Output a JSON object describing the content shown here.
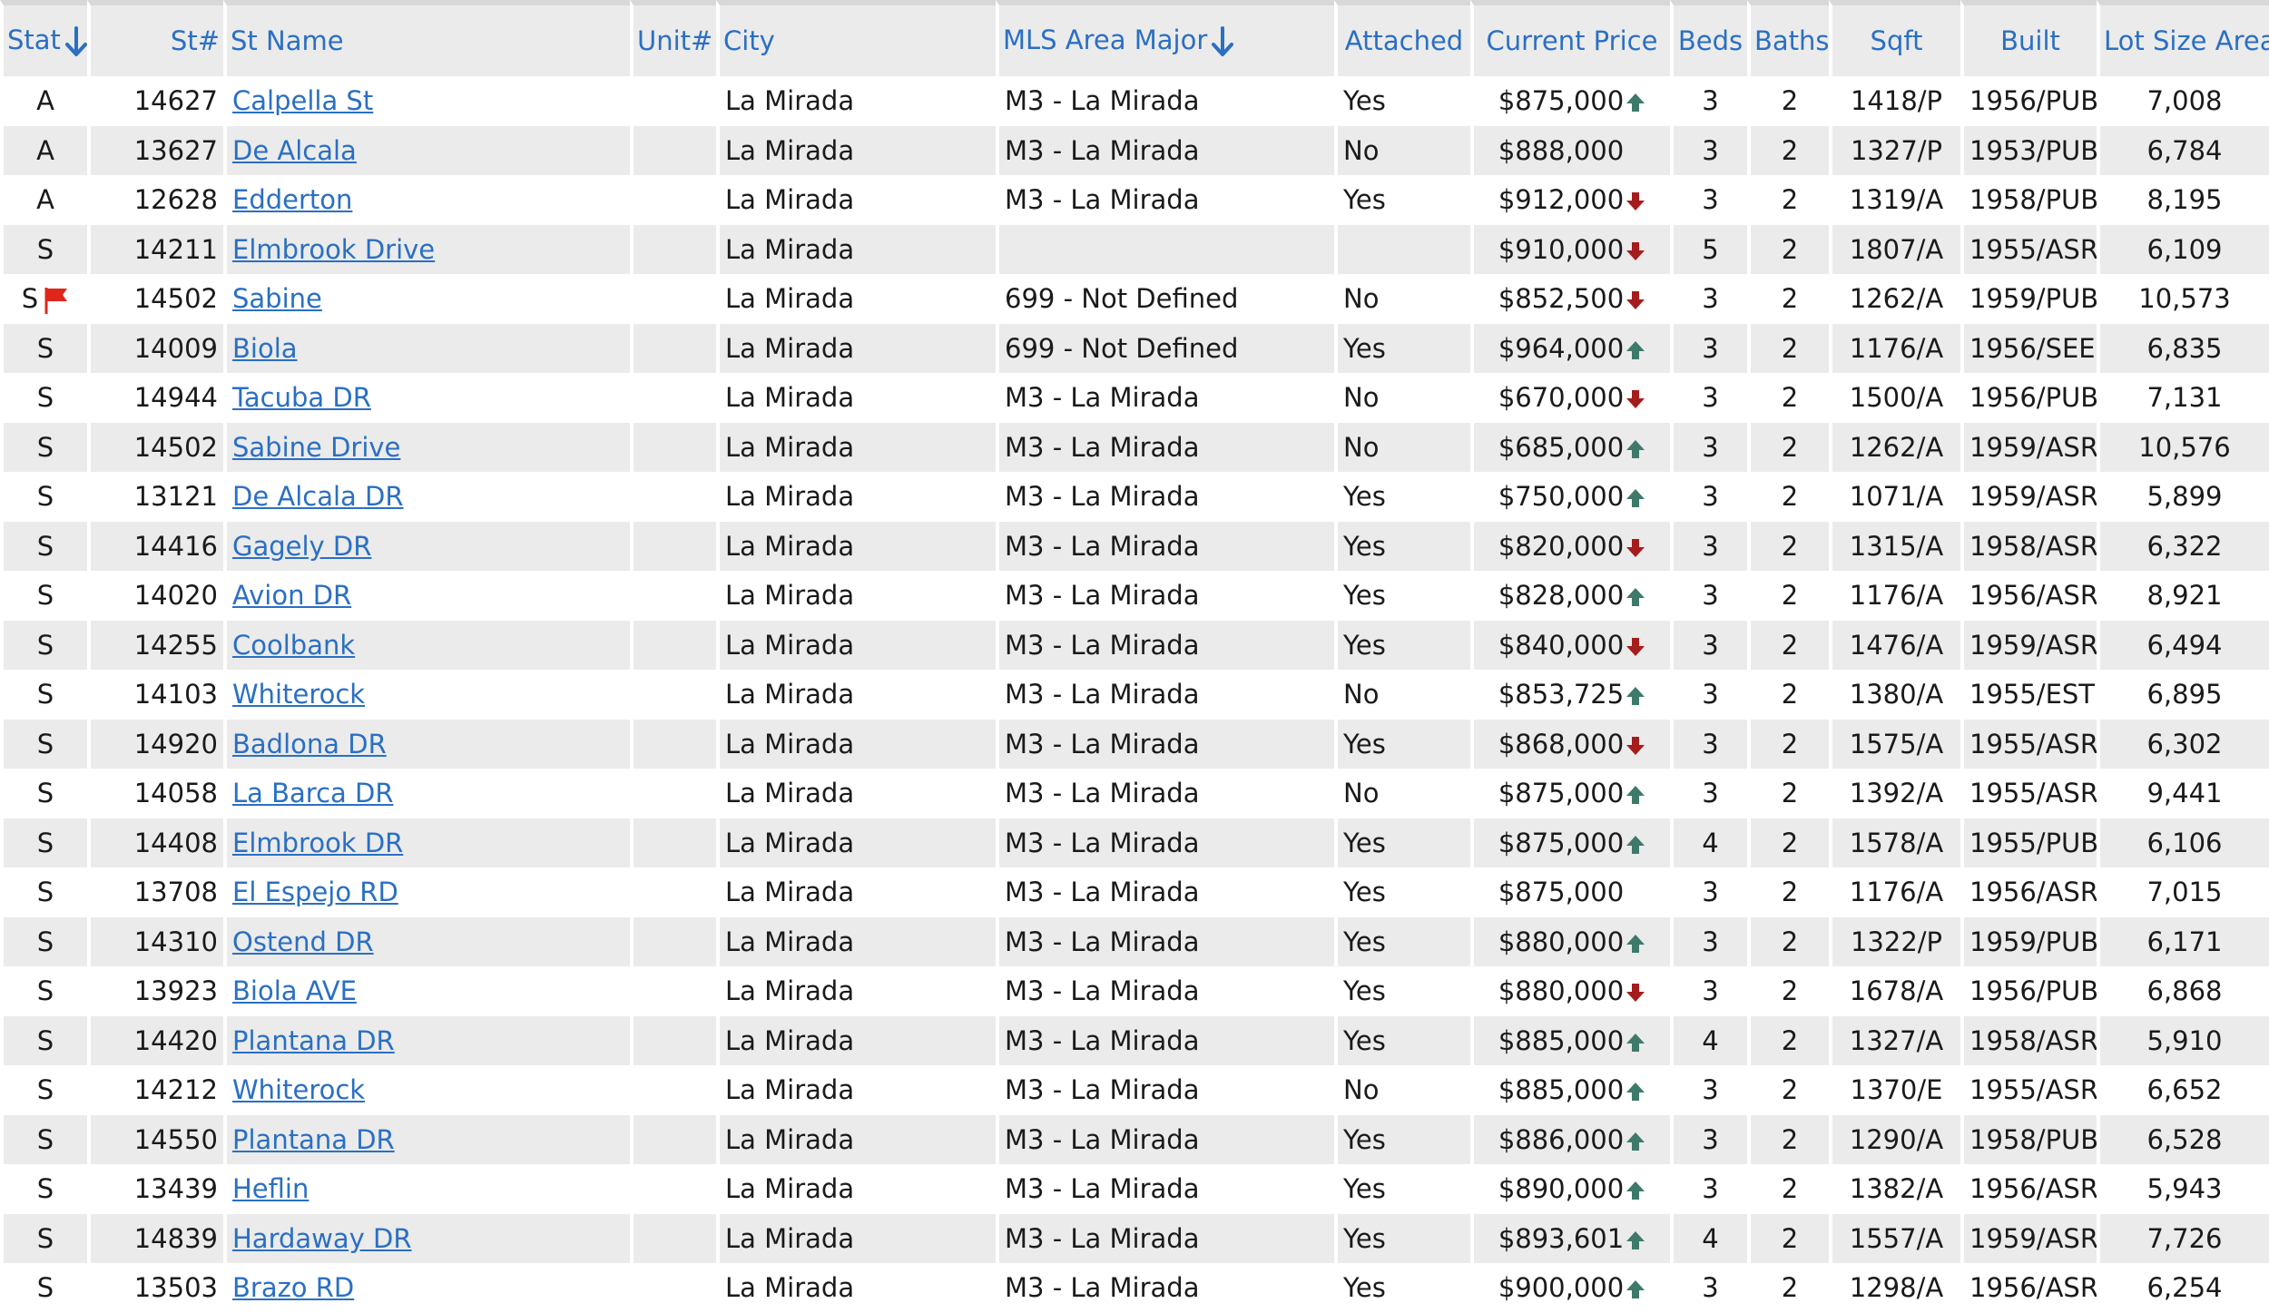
{
  "colors": {
    "link": "#2a6fc4",
    "row_alt": "#ebebeb",
    "header_bg": "#ebebeb",
    "trend_up": "#3d7a6b",
    "trend_down": "#a51c1c",
    "flag": "#e0251b"
  },
  "columns": {
    "stat": "Stat",
    "st_num": "St#",
    "st_name": "St Name",
    "unit": "Unit#",
    "city": "City",
    "mls_area": "MLS Area Major",
    "attached": "Attached",
    "price": "Current Price",
    "beds": "Beds",
    "baths": "Baths",
    "sqft": "Sqft",
    "built": "Built",
    "lot": "Lot Size Area"
  },
  "rows": [
    {
      "stat": "A",
      "flag": false,
      "num": "14627",
      "name": "Calpella St",
      "unit": "",
      "city": "La Mirada",
      "area": "M3 - La Mirada",
      "attached": "Yes",
      "price": "$875,000",
      "trend": "up",
      "beds": "3",
      "baths": "2",
      "sqft": "1418/P",
      "built": "1956/PUB",
      "lot": "7,008"
    },
    {
      "stat": "A",
      "flag": false,
      "num": "13627",
      "name": "De Alcala",
      "unit": "",
      "city": "La Mirada",
      "area": "M3 - La Mirada",
      "attached": "No",
      "price": "$888,000",
      "trend": "",
      "beds": "3",
      "baths": "2",
      "sqft": "1327/P",
      "built": "1953/PUB",
      "lot": "6,784"
    },
    {
      "stat": "A",
      "flag": false,
      "num": "12628",
      "name": "Edderton",
      "unit": "",
      "city": "La Mirada",
      "area": "M3 - La Mirada",
      "attached": "Yes",
      "price": "$912,000",
      "trend": "down",
      "beds": "3",
      "baths": "2",
      "sqft": "1319/A",
      "built": "1958/PUB",
      "lot": "8,195"
    },
    {
      "stat": "S",
      "flag": false,
      "num": "14211",
      "name": "Elmbrook Drive",
      "unit": "",
      "city": "La Mirada",
      "area": "",
      "attached": "",
      "price": "$910,000",
      "trend": "down",
      "beds": "5",
      "baths": "2",
      "sqft": "1807/A",
      "built": "1955/ASR",
      "lot": "6,109"
    },
    {
      "stat": "S",
      "flag": true,
      "num": "14502",
      "name": "Sabine",
      "unit": "",
      "city": "La Mirada",
      "area": "699 - Not Defined",
      "attached": "No",
      "price": "$852,500",
      "trend": "down",
      "beds": "3",
      "baths": "2",
      "sqft": "1262/A",
      "built": "1959/PUB",
      "lot": "10,573"
    },
    {
      "stat": "S",
      "flag": false,
      "num": "14009",
      "name": "Biola",
      "unit": "",
      "city": "La Mirada",
      "area": "699 - Not Defined",
      "attached": "Yes",
      "price": "$964,000",
      "trend": "up",
      "beds": "3",
      "baths": "2",
      "sqft": "1176/A",
      "built": "1956/SEE",
      "lot": "6,835"
    },
    {
      "stat": "S",
      "flag": false,
      "num": "14944",
      "name": "Tacuba DR",
      "unit": "",
      "city": "La Mirada",
      "area": "M3 - La Mirada",
      "attached": "No",
      "price": "$670,000",
      "trend": "down",
      "beds": "3",
      "baths": "2",
      "sqft": "1500/A",
      "built": "1956/PUB",
      "lot": "7,131"
    },
    {
      "stat": "S",
      "flag": false,
      "num": "14502",
      "name": "Sabine Drive",
      "unit": "",
      "city": "La Mirada",
      "area": "M3 - La Mirada",
      "attached": "No",
      "price": "$685,000",
      "trend": "up",
      "beds": "3",
      "baths": "2",
      "sqft": "1262/A",
      "built": "1959/ASR",
      "lot": "10,576"
    },
    {
      "stat": "S",
      "flag": false,
      "num": "13121",
      "name": "De Alcala DR",
      "unit": "",
      "city": "La Mirada",
      "area": "M3 - La Mirada",
      "attached": "Yes",
      "price": "$750,000",
      "trend": "up",
      "beds": "3",
      "baths": "2",
      "sqft": "1071/A",
      "built": "1959/ASR",
      "lot": "5,899"
    },
    {
      "stat": "S",
      "flag": false,
      "num": "14416",
      "name": "Gagely DR",
      "unit": "",
      "city": "La Mirada",
      "area": "M3 - La Mirada",
      "attached": "Yes",
      "price": "$820,000",
      "trend": "down",
      "beds": "3",
      "baths": "2",
      "sqft": "1315/A",
      "built": "1958/ASR",
      "lot": "6,322"
    },
    {
      "stat": "S",
      "flag": false,
      "num": "14020",
      "name": "Avion DR",
      "unit": "",
      "city": "La Mirada",
      "area": "M3 - La Mirada",
      "attached": "Yes",
      "price": "$828,000",
      "trend": "up",
      "beds": "3",
      "baths": "2",
      "sqft": "1176/A",
      "built": "1956/ASR",
      "lot": "8,921"
    },
    {
      "stat": "S",
      "flag": false,
      "num": "14255",
      "name": "Coolbank",
      "unit": "",
      "city": "La Mirada",
      "area": "M3 - La Mirada",
      "attached": "Yes",
      "price": "$840,000",
      "trend": "down",
      "beds": "3",
      "baths": "2",
      "sqft": "1476/A",
      "built": "1959/ASR",
      "lot": "6,494"
    },
    {
      "stat": "S",
      "flag": false,
      "num": "14103",
      "name": "Whiterock",
      "unit": "",
      "city": "La Mirada",
      "area": "M3 - La Mirada",
      "attached": "No",
      "price": "$853,725",
      "trend": "up",
      "beds": "3",
      "baths": "2",
      "sqft": "1380/A",
      "built": "1955/EST",
      "lot": "6,895"
    },
    {
      "stat": "S",
      "flag": false,
      "num": "14920",
      "name": "Badlona DR",
      "unit": "",
      "city": "La Mirada",
      "area": "M3 - La Mirada",
      "attached": "Yes",
      "price": "$868,000",
      "trend": "down",
      "beds": "3",
      "baths": "2",
      "sqft": "1575/A",
      "built": "1955/ASR",
      "lot": "6,302"
    },
    {
      "stat": "S",
      "flag": false,
      "num": "14058",
      "name": "La Barca DR",
      "unit": "",
      "city": "La Mirada",
      "area": "M3 - La Mirada",
      "attached": "No",
      "price": "$875,000",
      "trend": "up",
      "beds": "3",
      "baths": "2",
      "sqft": "1392/A",
      "built": "1955/ASR",
      "lot": "9,441"
    },
    {
      "stat": "S",
      "flag": false,
      "num": "14408",
      "name": "Elmbrook DR",
      "unit": "",
      "city": "La Mirada",
      "area": "M3 - La Mirada",
      "attached": "Yes",
      "price": "$875,000",
      "trend": "up",
      "beds": "4",
      "baths": "2",
      "sqft": "1578/A",
      "built": "1955/PUB",
      "lot": "6,106"
    },
    {
      "stat": "S",
      "flag": false,
      "num": "13708",
      "name": "El Espejo RD",
      "unit": "",
      "city": "La Mirada",
      "area": "M3 - La Mirada",
      "attached": "Yes",
      "price": "$875,000",
      "trend": "",
      "beds": "3",
      "baths": "2",
      "sqft": "1176/A",
      "built": "1956/ASR",
      "lot": "7,015"
    },
    {
      "stat": "S",
      "flag": false,
      "num": "14310",
      "name": "Ostend DR",
      "unit": "",
      "city": "La Mirada",
      "area": "M3 - La Mirada",
      "attached": "Yes",
      "price": "$880,000",
      "trend": "up",
      "beds": "3",
      "baths": "2",
      "sqft": "1322/P",
      "built": "1959/PUB",
      "lot": "6,171"
    },
    {
      "stat": "S",
      "flag": false,
      "num": "13923",
      "name": "Biola AVE",
      "unit": "",
      "city": "La Mirada",
      "area": "M3 - La Mirada",
      "attached": "Yes",
      "price": "$880,000",
      "trend": "down",
      "beds": "3",
      "baths": "2",
      "sqft": "1678/A",
      "built": "1956/PUB",
      "lot": "6,868"
    },
    {
      "stat": "S",
      "flag": false,
      "num": "14420",
      "name": "Plantana DR",
      "unit": "",
      "city": "La Mirada",
      "area": "M3 - La Mirada",
      "attached": "Yes",
      "price": "$885,000",
      "trend": "up",
      "beds": "4",
      "baths": "2",
      "sqft": "1327/A",
      "built": "1958/ASR",
      "lot": "5,910"
    },
    {
      "stat": "S",
      "flag": false,
      "num": "14212",
      "name": "Whiterock",
      "unit": "",
      "city": "La Mirada",
      "area": "M3 - La Mirada",
      "attached": "No",
      "price": "$885,000",
      "trend": "up",
      "beds": "3",
      "baths": "2",
      "sqft": "1370/E",
      "built": "1955/ASR",
      "lot": "6,652"
    },
    {
      "stat": "S",
      "flag": false,
      "num": "14550",
      "name": "Plantana DR",
      "unit": "",
      "city": "La Mirada",
      "area": "M3 - La Mirada",
      "attached": "Yes",
      "price": "$886,000",
      "trend": "up",
      "beds": "3",
      "baths": "2",
      "sqft": "1290/A",
      "built": "1958/PUB",
      "lot": "6,528"
    },
    {
      "stat": "S",
      "flag": false,
      "num": "13439",
      "name": "Heflin",
      "unit": "",
      "city": "La Mirada",
      "area": "M3 - La Mirada",
      "attached": "Yes",
      "price": "$890,000",
      "trend": "up",
      "beds": "3",
      "baths": "2",
      "sqft": "1382/A",
      "built": "1956/ASR",
      "lot": "5,943"
    },
    {
      "stat": "S",
      "flag": false,
      "num": "14839",
      "name": "Hardaway DR",
      "unit": "",
      "city": "La Mirada",
      "area": "M3 - La Mirada",
      "attached": "Yes",
      "price": "$893,601",
      "trend": "up",
      "beds": "4",
      "baths": "2",
      "sqft": "1557/A",
      "built": "1959/ASR",
      "lot": "7,726"
    },
    {
      "stat": "S",
      "flag": false,
      "num": "13503",
      "name": "Brazo RD",
      "unit": "",
      "city": "La Mirada",
      "area": "M3 - La Mirada",
      "attached": "Yes",
      "price": "$900,000",
      "trend": "up",
      "beds": "3",
      "baths": "2",
      "sqft": "1298/A",
      "built": "1956/ASR",
      "lot": "6,254"
    }
  ]
}
